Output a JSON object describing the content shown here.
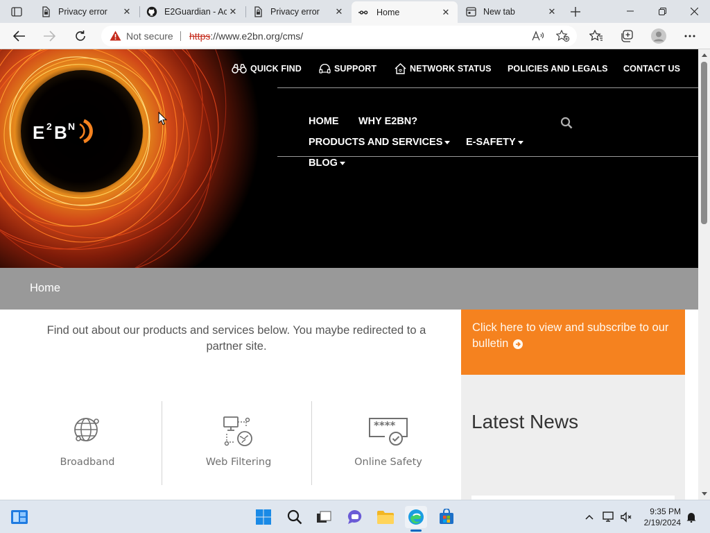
{
  "browser": {
    "tabs": [
      {
        "label": "Privacy error",
        "favicon": "privacy-error-icon",
        "active": false
      },
      {
        "label": "E2Guardian - Ac",
        "favicon": "github-icon",
        "active": false
      },
      {
        "label": "Privacy error",
        "favicon": "privacy-error-icon",
        "active": false
      },
      {
        "label": "Home",
        "favicon": "e2bn-favicon",
        "active": true
      },
      {
        "label": "New tab",
        "favicon": "new-tab-icon",
        "active": false
      }
    ],
    "address": {
      "security_label": "Not secure",
      "url_protocol": "https",
      "url_rest": "://www.e2bn.org/cms/"
    }
  },
  "site": {
    "logo_text": "E2BN",
    "top_nav": [
      {
        "label": "QUICK FIND",
        "icon": "binoculars-icon"
      },
      {
        "label": "SUPPORT",
        "icon": "support-icon"
      },
      {
        "label": "NETWORK STATUS",
        "icon": "network-home-icon"
      },
      {
        "label": "POLICIES AND LEGALS"
      },
      {
        "label": "CONTACT US"
      }
    ],
    "main_nav": [
      {
        "label": "HOME",
        "dropdown": false
      },
      {
        "label": "WHY E2BN?",
        "dropdown": false
      },
      {
        "label": "PRODUCTS AND SERVICES",
        "dropdown": true
      },
      {
        "label": "E-SAFETY",
        "dropdown": true
      },
      {
        "label": "BLOG",
        "dropdown": true
      }
    ],
    "breadcrumb": "Home",
    "intro": "Find out about our products and services below. You maybe redirected to a partner site.",
    "products": [
      {
        "label": "Broadband",
        "icon": "globe-icon"
      },
      {
        "label": "Web Filtering",
        "icon": "web-filtering-icon"
      },
      {
        "label": "Online Safety",
        "icon": "password-check-icon"
      }
    ],
    "bulletin_text": "Click here to view and subscribe to our bulletin",
    "news_title": "Latest News",
    "colors": {
      "accent_orange": "#f5821f",
      "header_bg": "#000000",
      "band_grey": "#999999"
    }
  },
  "taskbar": {
    "time": "9:35 PM",
    "date": "2/19/2024"
  }
}
